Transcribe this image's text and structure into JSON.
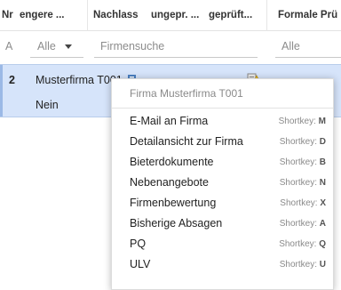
{
  "header": {
    "col_nr": "Nr",
    "col_engere": "engere ...",
    "col_nachlass": "Nachlass",
    "col_ungepr": "ungepr. ...",
    "col_geprueft": "geprüft...",
    "col_formale": "Formale Prü"
  },
  "filters": {
    "nr_value": "A",
    "engere_value": "Alle",
    "firmensuche_placeholder": "Firmensuche",
    "formale_value": "Alle"
  },
  "row": {
    "number": "2",
    "firm_name": "Musterfirma T001",
    "nein": "Nein"
  },
  "menu": {
    "title": "Firma Musterfirma T001",
    "shortkey_label": "Shortkey:",
    "items": [
      {
        "label": "E-Mail an Firma",
        "key": "M"
      },
      {
        "label": "Detailansicht zur Firma",
        "key": "D"
      },
      {
        "label": "Bieterdokumente",
        "key": "B"
      },
      {
        "label": "Nebenangebote",
        "key": "N"
      },
      {
        "label": "Firmenbewertung",
        "key": "X"
      },
      {
        "label": "Bisherige Absagen",
        "key": "A"
      },
      {
        "label": "PQ",
        "key": "Q"
      },
      {
        "label": "ULV",
        "key": "U"
      }
    ]
  },
  "colors": {
    "selected_row": "#d6e4fa",
    "menu_bg": "#ffffff",
    "menu_title": "#8a8a8a"
  }
}
